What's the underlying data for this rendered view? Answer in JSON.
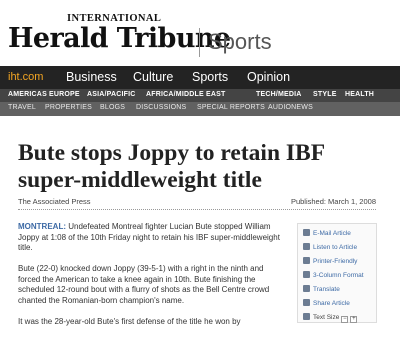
{
  "masthead": {
    "intl": "INTERNATIONAL",
    "logo": "Herald Tribune",
    "section": "Sports"
  },
  "nav_primary": {
    "home": "iht.com",
    "items": [
      "Business",
      "Culture",
      "Sports",
      "Opinion"
    ]
  },
  "nav_secondary": [
    "AMERICAS",
    "EUROPE",
    "ASIA/PACIFIC",
    "AFRICA/MIDDLE EAST",
    "TECH/MEDIA",
    "STYLE",
    "HEALTH"
  ],
  "nav_tertiary": [
    "TRAVEL",
    "PROPERTIES",
    "BLOGS",
    "DISCUSSIONS",
    "SPECIAL REPORTS",
    "AUDIONEWS"
  ],
  "article": {
    "title": "Bute stops Joppy to retain IBF super-middleweight title",
    "source": "The Associated Press",
    "published": "Published: March 1, 2008",
    "dateline": "MONTREAL:",
    "p1": " Undefeated Montreal fighter Lucian Bute stopped William Joppy at 1:08 of the 10th Friday night to retain his IBF super-middleweight title.",
    "p2": "Bute (22-0) knocked down Joppy (39-5-1) with a right in the ninth and forced the American to take a knee again in 10th. Bute finishing the scheduled 12-round bout with a flurry of shots as the Bell Centre crowd chanted the Romanian-born champion's name.",
    "p3": "It was the 28-year-old Bute's first defense of the title he won by"
  },
  "tools": {
    "email": "E-Mail Article",
    "listen": "Listen to Article",
    "print": "Printer-Friendly",
    "columns": "3-Column Format",
    "translate": "Translate",
    "share": "Share Article",
    "text_size": "Text Size",
    "minus": "−",
    "plus": "+"
  }
}
